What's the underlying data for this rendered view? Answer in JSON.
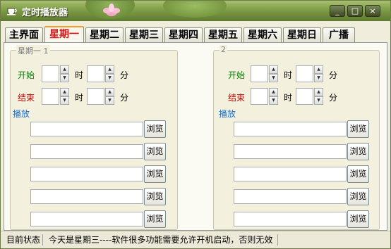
{
  "window": {
    "title": "定时播放器",
    "minimize_glyph": "_",
    "maximize_glyph": "□",
    "close_glyph": "×"
  },
  "tabs": [
    {
      "label": "主界面"
    },
    {
      "label": "星期一"
    },
    {
      "label": "星期二"
    },
    {
      "label": "星期三"
    },
    {
      "label": "星期四"
    },
    {
      "label": "星期五"
    },
    {
      "label": "星期六"
    },
    {
      "label": "星期日"
    },
    {
      "label": "广播"
    }
  ],
  "active_tab": "星期一",
  "groups": [
    {
      "title": "星期一 1",
      "start_label": "开始",
      "end_label": "结束",
      "hour_label": "时",
      "minute_label": "分",
      "play_label": "播放",
      "browse_label": "浏览",
      "start_hour": "",
      "start_minute": "",
      "end_hour": "",
      "end_minute": "",
      "files": [
        "",
        "",
        "",
        "",
        ""
      ]
    },
    {
      "title": "2",
      "start_label": "开始",
      "end_label": "结束",
      "hour_label": "时",
      "minute_label": "分",
      "play_label": "播放",
      "browse_label": "浏览",
      "start_hour": "",
      "start_minute": "",
      "end_hour": "",
      "end_minute": "",
      "files": [
        "",
        "",
        "",
        "",
        ""
      ]
    }
  ],
  "status": {
    "label": "目前状态",
    "message": "今天是星期三----软件很多功能需要允许开机启动，否则无效"
  },
  "colors": {
    "accent": "#f2a02a",
    "active_tab_text": "#d01818",
    "start_label": "#008000",
    "end_label": "#c00000",
    "play_label": "#1a6fd1",
    "titlebar": "#7f9c46"
  },
  "icons": {
    "app_icon": "teacup-icon",
    "title_decoration": "lotus-icon"
  }
}
